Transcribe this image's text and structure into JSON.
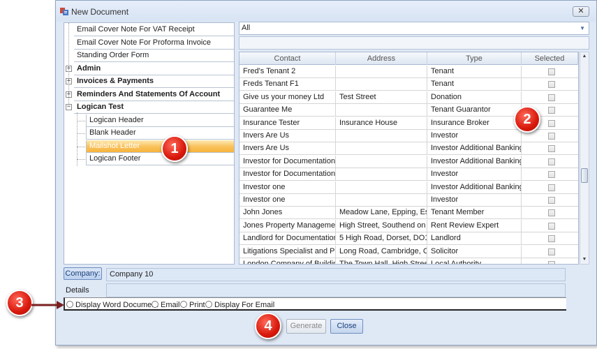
{
  "window": {
    "title": "New Document",
    "close_label": "✕"
  },
  "tree": {
    "items": [
      {
        "label": "Email Cover Note For VAT Receipt",
        "level": 0
      },
      {
        "label": "Email Cover Note For Proforma Invoice",
        "level": 0
      },
      {
        "label": "Standing Order Form",
        "level": 0
      },
      {
        "label": "Admin",
        "level": 0,
        "expander": "+"
      },
      {
        "label": "Invoices & Payments",
        "level": 0,
        "expander": "+"
      },
      {
        "label": "Reminders And Statements Of Account",
        "level": 0,
        "expander": "+"
      },
      {
        "label": "Logican Test",
        "level": 0,
        "expander": "−"
      },
      {
        "label": "Logican Header",
        "level": 1
      },
      {
        "label": "Blank Header",
        "level": 1
      },
      {
        "label": "Mailshot Letter",
        "level": 1,
        "selected": true
      },
      {
        "label": "Logican Footer",
        "level": 1
      }
    ]
  },
  "filter": {
    "selected": "All"
  },
  "grid": {
    "columns": [
      "Contact",
      "Address",
      "Type",
      "Selected"
    ],
    "rows": [
      {
        "contact": "Fred's Tenant 2",
        "address": "",
        "type": "Tenant"
      },
      {
        "contact": "Freds Tenant F1",
        "address": "",
        "type": "Tenant"
      },
      {
        "contact": "Give us your money Ltd",
        "address": "Test Street",
        "type": "Donation"
      },
      {
        "contact": "Guarantee Me",
        "address": "",
        "type": "Tenant Guarantor"
      },
      {
        "contact": "Insurance Tester",
        "address": "Insurance House",
        "type": "Insurance Broker"
      },
      {
        "contact": "Invers Are Us",
        "address": "",
        "type": "Investor"
      },
      {
        "contact": "Invers Are Us",
        "address": "",
        "type": "Investor Additional Banking C"
      },
      {
        "contact": "Investor for Documentation",
        "address": "",
        "type": "Investor Additional Banking C"
      },
      {
        "contact": "Investor for Documentation",
        "address": "",
        "type": "Investor"
      },
      {
        "contact": "Investor one",
        "address": "",
        "type": "Investor Additional Banking C"
      },
      {
        "contact": "Investor one",
        "address": "",
        "type": "Investor"
      },
      {
        "contact": "John Jones",
        "address": "Meadow Lane, Epping, Essex,",
        "type": "Tenant Member"
      },
      {
        "contact": "Jones Property Management",
        "address": "High Street, Southend on Se",
        "type": "Rent Review Expert"
      },
      {
        "contact": "Landlord for Documentation",
        "address": "5 High Road, Dorset, DO1 1",
        "type": "Landlord"
      },
      {
        "contact": "Litigations Specialist and Partn",
        "address": "Long Road, Cambridge, Cam",
        "type": "Solicitor"
      },
      {
        "contact": "London Company of Building",
        "address": "The Town Hall, High Street",
        "type": "Local Authority"
      }
    ]
  },
  "company": {
    "button_label": "Company:",
    "value": "Company 10"
  },
  "details": {
    "label": "Details",
    "value": ""
  },
  "options": [
    "Display Word Document",
    "Email",
    "Print",
    "Display For Email"
  ],
  "buttons": {
    "generate": "Generate",
    "close": "Close"
  },
  "callouts": [
    "1",
    "2",
    "3",
    "4"
  ]
}
